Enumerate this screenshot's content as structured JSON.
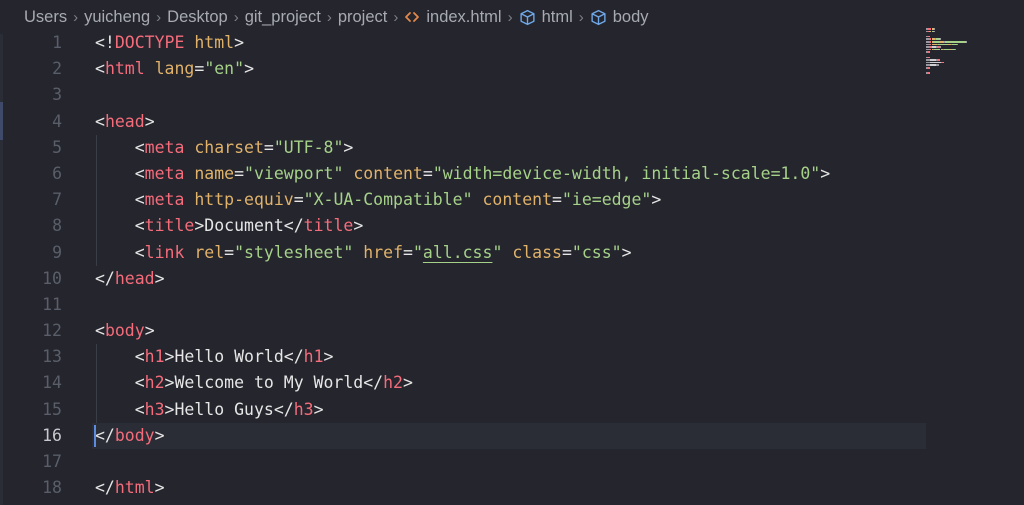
{
  "breadcrumb": {
    "items": [
      "Users",
      "yuicheng",
      "Desktop",
      "git_project",
      "project",
      "index.html",
      "html",
      "body"
    ],
    "icons": {
      "index.html": "code-file-icon",
      "html": "cube-icon",
      "body": "cube-icon"
    }
  },
  "editor": {
    "current_line": 16,
    "lines": [
      {
        "n": "1",
        "tokens": [
          {
            "c": "punc",
            "t": "<!"
          },
          {
            "c": "tag",
            "t": "DOCTYPE"
          },
          {
            "c": "punc",
            "t": " "
          },
          {
            "c": "attr",
            "t": "html"
          },
          {
            "c": "punc",
            "t": ">"
          }
        ]
      },
      {
        "n": "2",
        "tokens": [
          {
            "c": "punc",
            "t": "<"
          },
          {
            "c": "tag",
            "t": "html"
          },
          {
            "c": "punc",
            "t": " "
          },
          {
            "c": "attr",
            "t": "lang"
          },
          {
            "c": "punc",
            "t": "="
          },
          {
            "c": "str",
            "t": "\"en\""
          },
          {
            "c": "punc",
            "t": ">"
          }
        ]
      },
      {
        "n": "3",
        "tokens": []
      },
      {
        "n": "4",
        "tokens": [
          {
            "c": "punc",
            "t": "<"
          },
          {
            "c": "tag",
            "t": "head"
          },
          {
            "c": "punc",
            "t": ">"
          }
        ]
      },
      {
        "n": "5",
        "tokens": [
          {
            "c": "punc",
            "t": "    <"
          },
          {
            "c": "tag",
            "t": "meta"
          },
          {
            "c": "punc",
            "t": " "
          },
          {
            "c": "attr",
            "t": "charset"
          },
          {
            "c": "punc",
            "t": "="
          },
          {
            "c": "str",
            "t": "\"UTF-8\""
          },
          {
            "c": "punc",
            "t": ">"
          }
        ]
      },
      {
        "n": "6",
        "tokens": [
          {
            "c": "punc",
            "t": "    <"
          },
          {
            "c": "tag",
            "t": "meta"
          },
          {
            "c": "punc",
            "t": " "
          },
          {
            "c": "attr",
            "t": "name"
          },
          {
            "c": "punc",
            "t": "="
          },
          {
            "c": "str",
            "t": "\"viewport\""
          },
          {
            "c": "punc",
            "t": " "
          },
          {
            "c": "attr",
            "t": "content"
          },
          {
            "c": "punc",
            "t": "="
          },
          {
            "c": "str",
            "t": "\"width=device-width, initial-scale=1.0\""
          },
          {
            "c": "punc",
            "t": ">"
          }
        ]
      },
      {
        "n": "7",
        "tokens": [
          {
            "c": "punc",
            "t": "    <"
          },
          {
            "c": "tag",
            "t": "meta"
          },
          {
            "c": "punc",
            "t": " "
          },
          {
            "c": "attr",
            "t": "http-equiv"
          },
          {
            "c": "punc",
            "t": "="
          },
          {
            "c": "str",
            "t": "\"X-UA-Compatible\""
          },
          {
            "c": "punc",
            "t": " "
          },
          {
            "c": "attr",
            "t": "content"
          },
          {
            "c": "punc",
            "t": "="
          },
          {
            "c": "str",
            "t": "\"ie=edge\""
          },
          {
            "c": "punc",
            "t": ">"
          }
        ]
      },
      {
        "n": "8",
        "tokens": [
          {
            "c": "punc",
            "t": "    <"
          },
          {
            "c": "tag",
            "t": "title"
          },
          {
            "c": "punc",
            "t": ">"
          },
          {
            "c": "text",
            "t": "Document"
          },
          {
            "c": "punc",
            "t": "</"
          },
          {
            "c": "tag",
            "t": "title"
          },
          {
            "c": "punc",
            "t": ">"
          }
        ]
      },
      {
        "n": "9",
        "tokens": [
          {
            "c": "punc",
            "t": "    <"
          },
          {
            "c": "tag",
            "t": "link"
          },
          {
            "c": "punc",
            "t": " "
          },
          {
            "c": "attr",
            "t": "rel"
          },
          {
            "c": "punc",
            "t": "="
          },
          {
            "c": "str",
            "t": "\"stylesheet\""
          },
          {
            "c": "punc",
            "t": " "
          },
          {
            "c": "attr",
            "t": "href"
          },
          {
            "c": "punc",
            "t": "="
          },
          {
            "c": "str",
            "t": "\""
          },
          {
            "c": "str link",
            "t": "all.css"
          },
          {
            "c": "str",
            "t": "\""
          },
          {
            "c": "punc",
            "t": " "
          },
          {
            "c": "attr",
            "t": "class"
          },
          {
            "c": "punc",
            "t": "="
          },
          {
            "c": "str",
            "t": "\"css\""
          },
          {
            "c": "punc",
            "t": ">"
          }
        ]
      },
      {
        "n": "10",
        "tokens": [
          {
            "c": "punc",
            "t": "</"
          },
          {
            "c": "tag",
            "t": "head"
          },
          {
            "c": "punc",
            "t": ">"
          }
        ]
      },
      {
        "n": "11",
        "tokens": []
      },
      {
        "n": "12",
        "tokens": [
          {
            "c": "punc",
            "t": "<"
          },
          {
            "c": "tag",
            "t": "body"
          },
          {
            "c": "punc",
            "t": ">"
          }
        ]
      },
      {
        "n": "13",
        "tokens": [
          {
            "c": "punc",
            "t": "    <"
          },
          {
            "c": "tag",
            "t": "h1"
          },
          {
            "c": "punc",
            "t": ">"
          },
          {
            "c": "text",
            "t": "Hello World"
          },
          {
            "c": "punc",
            "t": "</"
          },
          {
            "c": "tag",
            "t": "h1"
          },
          {
            "c": "punc",
            "t": ">"
          }
        ]
      },
      {
        "n": "14",
        "tokens": [
          {
            "c": "punc",
            "t": "    <"
          },
          {
            "c": "tag",
            "t": "h2"
          },
          {
            "c": "punc",
            "t": ">"
          },
          {
            "c": "text",
            "t": "Welcome to My World"
          },
          {
            "c": "punc",
            "t": "</"
          },
          {
            "c": "tag",
            "t": "h2"
          },
          {
            "c": "punc",
            "t": ">"
          }
        ]
      },
      {
        "n": "15",
        "tokens": [
          {
            "c": "punc",
            "t": "    <"
          },
          {
            "c": "tag",
            "t": "h3"
          },
          {
            "c": "punc",
            "t": ">"
          },
          {
            "c": "text",
            "t": "Hello Guys"
          },
          {
            "c": "punc",
            "t": "</"
          },
          {
            "c": "tag",
            "t": "h3"
          },
          {
            "c": "punc",
            "t": ">"
          }
        ]
      },
      {
        "n": "16",
        "tokens": [
          {
            "c": "punc",
            "t": "</"
          },
          {
            "c": "tag",
            "t": "body"
          },
          {
            "c": "punc",
            "t": ">"
          }
        ]
      },
      {
        "n": "17",
        "tokens": []
      },
      {
        "n": "18",
        "tokens": [
          {
            "c": "punc",
            "t": "</"
          },
          {
            "c": "tag",
            "t": "html"
          },
          {
            "c": "punc",
            "t": ">"
          }
        ]
      }
    ]
  },
  "colors": {
    "background": "#24252d",
    "tag": "#f56c7b",
    "attribute": "#e0b26a",
    "string": "#a6d189",
    "text": "#e6e6e6",
    "line_number": "#5a5e69",
    "cursor": "#5b8ce0"
  }
}
